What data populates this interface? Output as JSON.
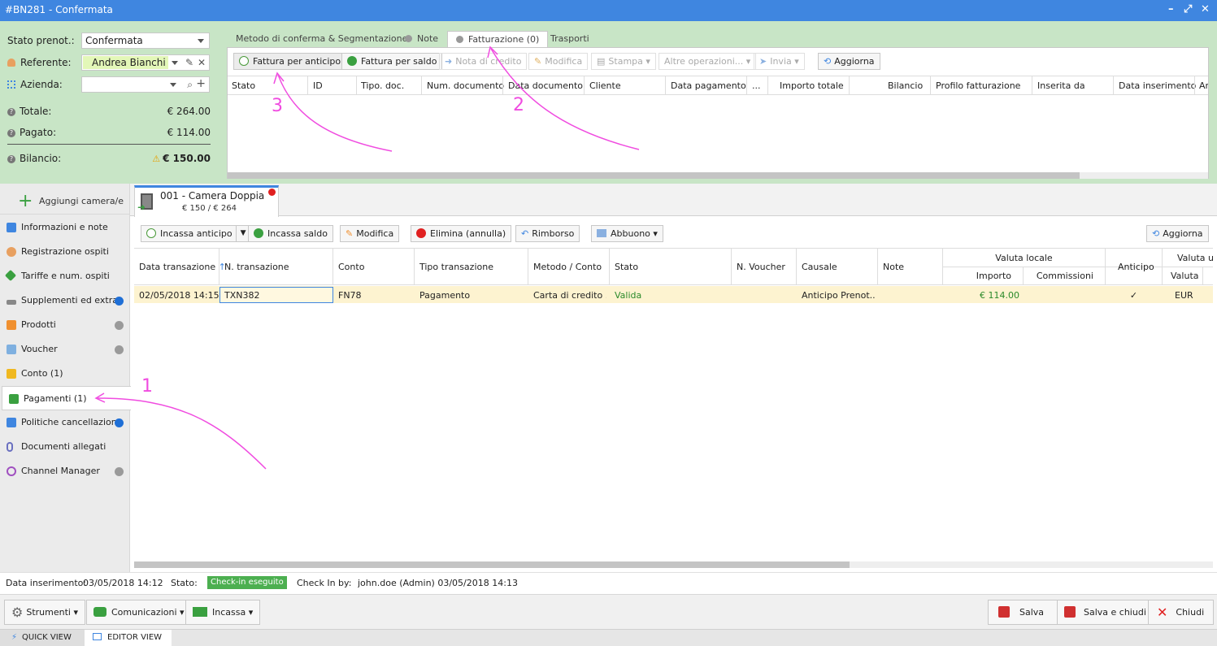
{
  "window": {
    "title": "#BN281 - Confermata",
    "controls": [
      "–",
      "⤢",
      "✕"
    ]
  },
  "booking": {
    "stato_label": "Stato prenot.:",
    "stato_value": "Confermata",
    "referente_label": "Referente:",
    "referente_value": "Andrea Bianchi",
    "azienda_label": "Azienda:",
    "azienda_value": "",
    "totale_label": "Totale:",
    "totale_value": "€ 264.00",
    "pagato_label": "Pagato:",
    "pagato_value": "€ 114.00",
    "bilancio_label": "Bilancio:",
    "bilancio_value": "€ 150.00"
  },
  "top_tabs": [
    {
      "label": "Metodo di conferma & Segmentazione"
    },
    {
      "label": "Note"
    },
    {
      "label": "Fatturazione (0)"
    },
    {
      "label": "Trasporti"
    }
  ],
  "invoice_toolbar": {
    "fattura_anticipo": "Fattura per anticipo",
    "fattura_saldo": "Fattura per saldo",
    "nota_credito": "Nota di credito",
    "modifica": "Modifica",
    "stampa": "Stampa",
    "altre": "Altre operazioni...",
    "invia": "Invia",
    "aggiorna": "Aggiorna"
  },
  "invoice_columns": [
    "Stato",
    "ID",
    "Tipo. doc.",
    "Num. documento",
    "Data documento",
    "Cliente",
    "Data pagamento",
    "...",
    "Importo totale",
    "Bilancio",
    "Profilo fatturazione",
    "Inserita da",
    "Data inserimento",
    "An"
  ],
  "sidebar": {
    "add_room": "Aggiungi camera/e",
    "items": [
      {
        "label": "Informazioni e note"
      },
      {
        "label": "Registrazione ospiti"
      },
      {
        "label": "Tariffe e num. ospiti"
      },
      {
        "label": "Supplementi ed extra"
      },
      {
        "label": "Prodotti"
      },
      {
        "label": "Voucher"
      },
      {
        "label": "Conto (1)"
      },
      {
        "label": "Pagamenti (1)"
      },
      {
        "label": "Politiche cancellazione"
      },
      {
        "label": "Documenti allegati"
      },
      {
        "label": "Channel Manager"
      }
    ]
  },
  "room_tab": {
    "title": "001 - Camera Doppia",
    "subtitle": "€ 150 / € 264"
  },
  "payments_toolbar": {
    "incassa_anticipo": "Incassa anticipo",
    "incassa_saldo": "Incassa saldo",
    "modifica": "Modifica",
    "elimina": "Elimina (annulla)",
    "rimborso": "Rimborso",
    "abbuono": "Abbuono",
    "aggiorna": "Aggiorna"
  },
  "payments_columns": {
    "data": "Data transazione",
    "num": "N. transazione",
    "conto": "Conto",
    "tipo": "Tipo transazione",
    "metodo": "Metodo / Conto",
    "stato": "Stato",
    "voucher": "N. Voucher",
    "causale": "Causale",
    "note": "Note",
    "valuta_locale": "Valuta locale",
    "importo": "Importo",
    "commissioni": "Commissioni",
    "anticipo": "Anticipo",
    "valuta_ut": "Valuta ut",
    "valuta": "Valuta"
  },
  "payments_row": {
    "data": "02/05/2018 14:15",
    "num": "TXN382",
    "conto": "FN78",
    "tipo": "Pagamento",
    "metodo": "Carta di credito ...",
    "stato": "Valida",
    "voucher": "",
    "causale": "Anticipo Prenot...",
    "note": "",
    "importo": "€ 114.00",
    "commissioni": "",
    "anticipo": "✓",
    "valuta": "EUR"
  },
  "status_bar": {
    "inserimento_label": "Data inserimento:",
    "inserimento_value": "03/05/2018 14:12",
    "stato_label": "Stato:",
    "stato_value": "Check-in eseguito",
    "checkin_label": "Check In by:",
    "checkin_value": "john.doe (Admin) 03/05/2018 14:13"
  },
  "footer": {
    "strumenti": "Strumenti",
    "comunicazioni": "Comunicazioni",
    "incassa": "Incassa",
    "salva": "Salva",
    "salva_chiudi": "Salva e chiudi",
    "chiudi": "Chiudi"
  },
  "view_tabs": {
    "quick": "QUICK VIEW",
    "editor": "EDITOR VIEW"
  },
  "annotations": {
    "a1": "1",
    "a2": "2",
    "a3": "3"
  },
  "colors": {
    "titlebar": "#3f86e0",
    "panel_bg": "#c8e5c6",
    "row_highlight": "#fdf3d0",
    "annotation": "#f04ce0",
    "status_badge": "#4caf50"
  }
}
